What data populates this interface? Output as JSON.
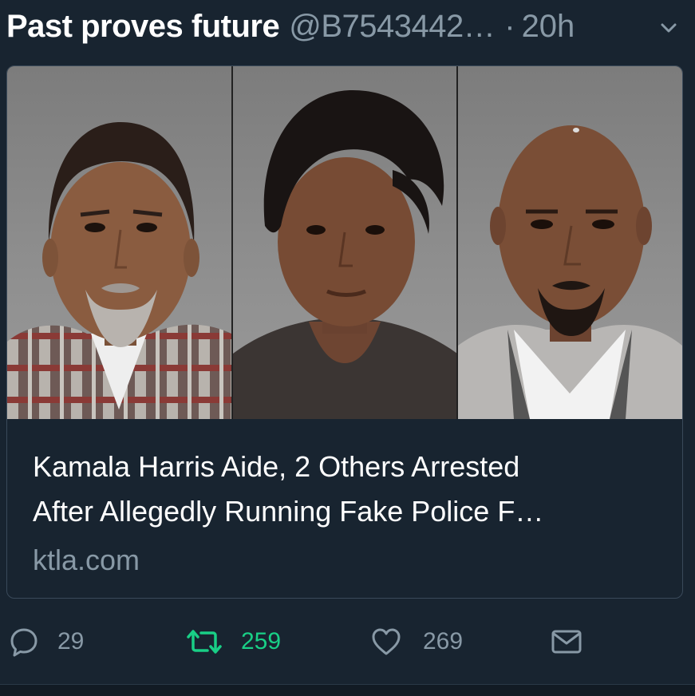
{
  "tweet": {
    "display_name": "Past proves future",
    "handle": "@B7543442…",
    "separator": "·",
    "time": "20h",
    "menu_icon": "chevron-down-icon"
  },
  "card": {
    "title_line1": "Kamala Harris Aide, 2 Others Arrested",
    "title_line2": "After Allegedly Running Fake Police F…",
    "domain": "ktla.com"
  },
  "actions": {
    "reply": {
      "icon": "reply-icon",
      "count": "29"
    },
    "retweet": {
      "icon": "retweet-icon",
      "count": "259",
      "color": "#19cf86"
    },
    "like": {
      "icon": "heart-icon",
      "count": "269"
    },
    "message": {
      "icon": "envelope-icon"
    }
  },
  "colors": {
    "background": "#182430",
    "secondary_text": "#8899a6",
    "retweet_green": "#19cf86"
  }
}
